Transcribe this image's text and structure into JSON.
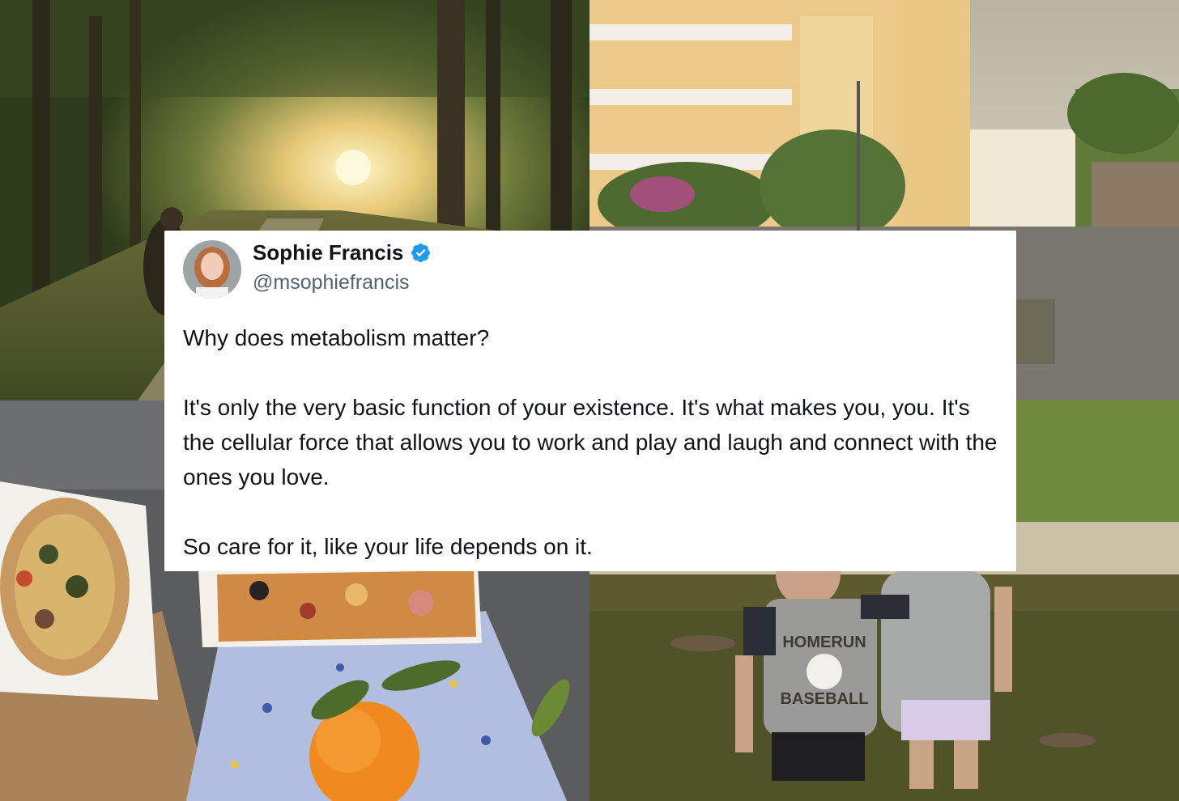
{
  "tweet": {
    "display_name": "Sophie Francis",
    "handle": "@msophiefrancis",
    "verified_icon": "verified-badge-icon",
    "lines": [
      "Why does metabolism matter?",
      "It's only the very basic function of your existence. It's what makes you, you. It's the cellular force that allows you to work and play and laugh and connect with the ones you love.",
      "So care for it, like your life depends on it."
    ]
  },
  "photos": {
    "shirt_text_top": "HOMERUN",
    "shirt_text_bottom": "BASEBALL"
  },
  "colors": {
    "verified_blue": "#1d9bf0",
    "card_bg": "#ffffff",
    "handle_gray": "#536471"
  }
}
